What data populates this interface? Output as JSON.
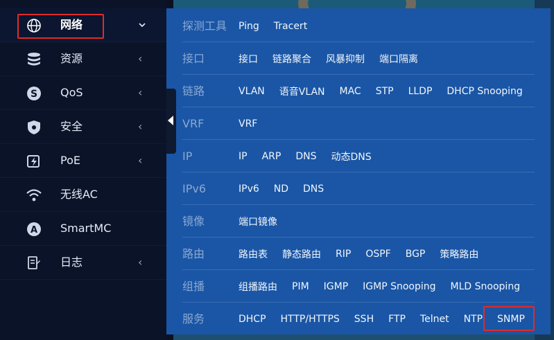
{
  "sidebar": {
    "items": [
      {
        "label": "网络",
        "icon": "globe-icon",
        "chevron": "⌄",
        "active": true
      },
      {
        "label": "资源",
        "icon": "database-icon",
        "chevron": "‹"
      },
      {
        "label": "QoS",
        "icon": "qos-icon",
        "chevron": "‹"
      },
      {
        "label": "安全",
        "icon": "shield-icon",
        "chevron": "‹"
      },
      {
        "label": "PoE",
        "icon": "poe-power-icon",
        "chevron": "‹"
      },
      {
        "label": "无线AC",
        "icon": "wifi-icon",
        "chevron": ""
      },
      {
        "label": "SmartMC",
        "icon": "smartmc-icon",
        "chevron": ""
      },
      {
        "label": "日志",
        "icon": "log-document-icon",
        "chevron": "‹"
      }
    ]
  },
  "submenu": {
    "rows": [
      {
        "category": "探测工具",
        "links": [
          "Ping",
          "Tracert"
        ]
      },
      {
        "category": "接口",
        "links": [
          "接口",
          "链路聚合",
          "风暴抑制",
          "端口隔离"
        ]
      },
      {
        "category": "链路",
        "links": [
          "VLAN",
          "语音VLAN",
          "MAC",
          "STP",
          "LLDP",
          "DHCP Snooping"
        ]
      },
      {
        "category": "VRF",
        "links": [
          "VRF"
        ]
      },
      {
        "category": "IP",
        "links": [
          "IP",
          "ARP",
          "DNS",
          "动态DNS"
        ]
      },
      {
        "category": "IPv6",
        "links": [
          "IPv6",
          "ND",
          "DNS"
        ]
      },
      {
        "category": "镜像",
        "links": [
          "端口镜像"
        ]
      },
      {
        "category": "路由",
        "links": [
          "路由表",
          "静态路由",
          "RIP",
          "OSPF",
          "BGP",
          "策略路由"
        ]
      },
      {
        "category": "组播",
        "links": [
          "组播路由",
          "PIM",
          "IGMP",
          "IGMP Snooping",
          "MLD Snooping"
        ]
      },
      {
        "category": "服务",
        "links": [
          "DHCP",
          "HTTP/HTTPS",
          "SSH",
          "FTP",
          "Telnet",
          "NTP",
          "SNMP"
        ]
      }
    ]
  },
  "colors": {
    "sidebar_bg": "#0a1328",
    "panel_bg": "#1a56a5",
    "highlight": "#e02b2b",
    "category_text": "#8aa8d2"
  }
}
